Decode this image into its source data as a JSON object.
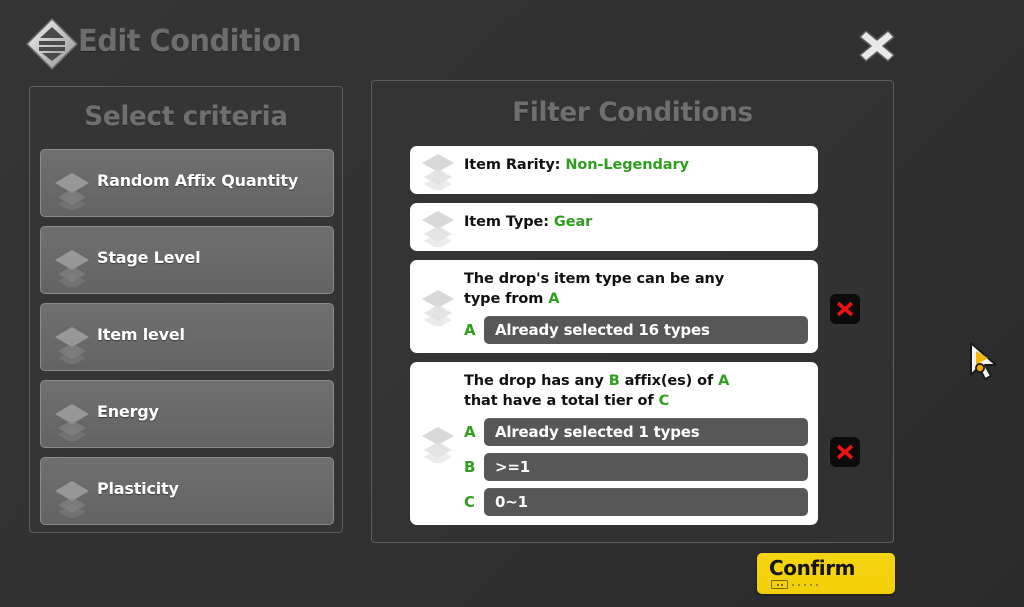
{
  "header": {
    "title": "Edit Condition",
    "icon": "filter-diamond-icon",
    "close_icon": "close-icon"
  },
  "left_panel": {
    "title": "Select criteria",
    "items": [
      {
        "label": "Random Affix Quantity",
        "icon": "layers-icon"
      },
      {
        "label": "Stage Level",
        "icon": "layers-icon"
      },
      {
        "label": "Item level",
        "icon": "layers-icon"
      },
      {
        "label": "Energy",
        "icon": "layers-icon"
      },
      {
        "label": "Plasticity",
        "icon": "layers-icon"
      }
    ]
  },
  "right_panel": {
    "title": "Filter Conditions",
    "conditions": [
      {
        "type": "simple",
        "label": "Item Rarity:",
        "value": "Non-Legendary",
        "icon": "layers-icon",
        "deletable": false
      },
      {
        "type": "simple",
        "label": "Item Type:",
        "value": "Gear",
        "icon": "layers-icon",
        "deletable": false
      },
      {
        "type": "params",
        "text_line1": "The drop's item type can be any",
        "text_line2_prefix": "type from ",
        "text_line2_ref": "A",
        "icon": "layers-icon",
        "deletable": true,
        "delete_icon": "delete-x-icon",
        "rows": [
          {
            "letter": "A",
            "value": "Already selected 16 types"
          }
        ]
      },
      {
        "type": "params",
        "text_line1_a": "The drop has any ",
        "text_line1_refB": "B",
        "text_line1_b": " affix(es) of ",
        "text_line1_refA": "A",
        "text_line2_a": "that have a total tier of ",
        "text_line2_refC": "C",
        "icon": "layers-icon",
        "deletable": true,
        "delete_icon": "delete-x-icon",
        "rows": [
          {
            "letter": "A",
            "value": "Already selected 1 types"
          },
          {
            "letter": "B",
            "value": ">=1"
          },
          {
            "letter": "C",
            "value": "0~1"
          }
        ]
      }
    ]
  },
  "confirm": {
    "label": "Confirm",
    "hint_icon": "key-hint-icon"
  },
  "cursor": {
    "icon": "mouse-pointer-icon"
  },
  "colors": {
    "accent_green": "#2f9e1f",
    "confirm_yellow": "#f2cf0a",
    "delete_red": "#ee1111",
    "panel_border": "#5d5d5d",
    "background": "#323232"
  }
}
